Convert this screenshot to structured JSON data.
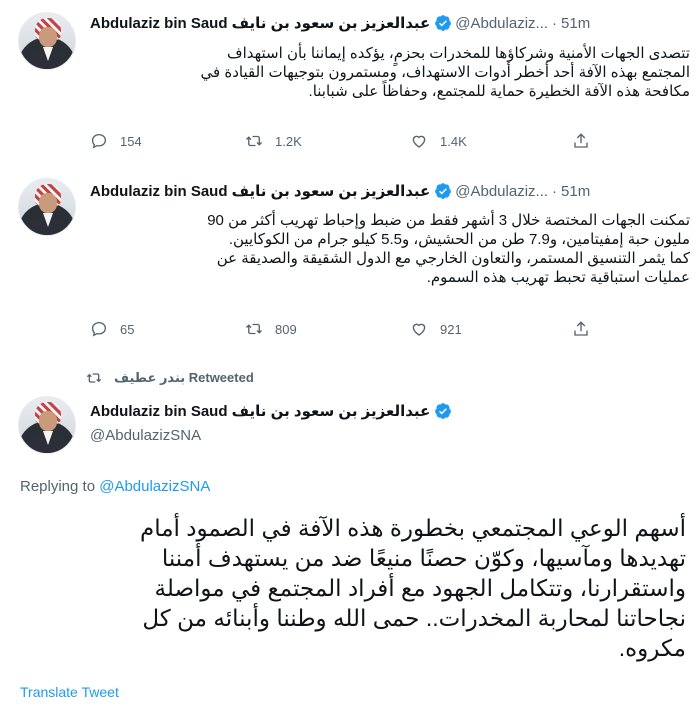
{
  "colors": {
    "accent": "#1d9bf0",
    "text": "#0f1419",
    "muted": "#536471"
  },
  "tweet1": {
    "name": "Abdulaziz bin Saud عبدالعزيز بن سعود بن نايف",
    "handle": "@Abdulaziz...",
    "dot": "·",
    "time": "51m",
    "text": "تتصدى الجهات الأمنية وشركاؤها للمخدرات بحزمٍ، يؤكده إيماننا بأن استهداف\nالمجتمع بهذه الآفة أحد أخطر أدوات الاستهداف، ومستمرون بتوجيهات القيادة في\nمكافحة هذه الآفة الخطيرة حماية للمجتمع، وحفاظاً على شبابنا.",
    "replies": "154",
    "retweets": "1.2K",
    "likes": "1.4K"
  },
  "tweet2": {
    "name": "Abdulaziz bin Saud عبدالعزيز بن سعود بن نايف",
    "handle": "@Abdulaziz...",
    "dot": "·",
    "time": "51m",
    "text": "تمكنت الجهات المختصة خلال 3 أشهر فقط من ضبط وإحباط تهريب أكثر من 90\nمليون حبة إمفيتامين، و7.9 طن من الحشيش، و5.5 كيلو جرام من الكوكايين.\nكما يثمر التنسيق المستمر، والتعاون الخارجي مع الدول الشقيقة والصديقة عن\nعمليات استباقية تحبط تهريب هذه السموم.",
    "replies": "65",
    "retweets": "809",
    "likes": "921"
  },
  "retweet_banner": {
    "label": "بندر عطيف Retweeted"
  },
  "main_tweet": {
    "name": "Abdulaziz bin Saud عبدالعزيز بن سعود بن نايف",
    "handle": "@AbdulazizSNA",
    "replying_prefix": "Replying to ",
    "replying_handle": "@AbdulazizSNA",
    "text": "أسهم الوعي المجتمعي بخطورة هذه الآفة في الصمود أمام\nتهديدها ومآسيها، وكوّن حصنًا منيعًا ضد من يستهدف أمننا\nواستقرارنا، وتتكامل الجهود مع أفراد المجتمع في مواصلة\nنجاحاتنا لمحاربة المخدرات.. حمى الله وطننا وأبنائه من كل\nمكروه.",
    "translate_label": "Translate Tweet"
  }
}
